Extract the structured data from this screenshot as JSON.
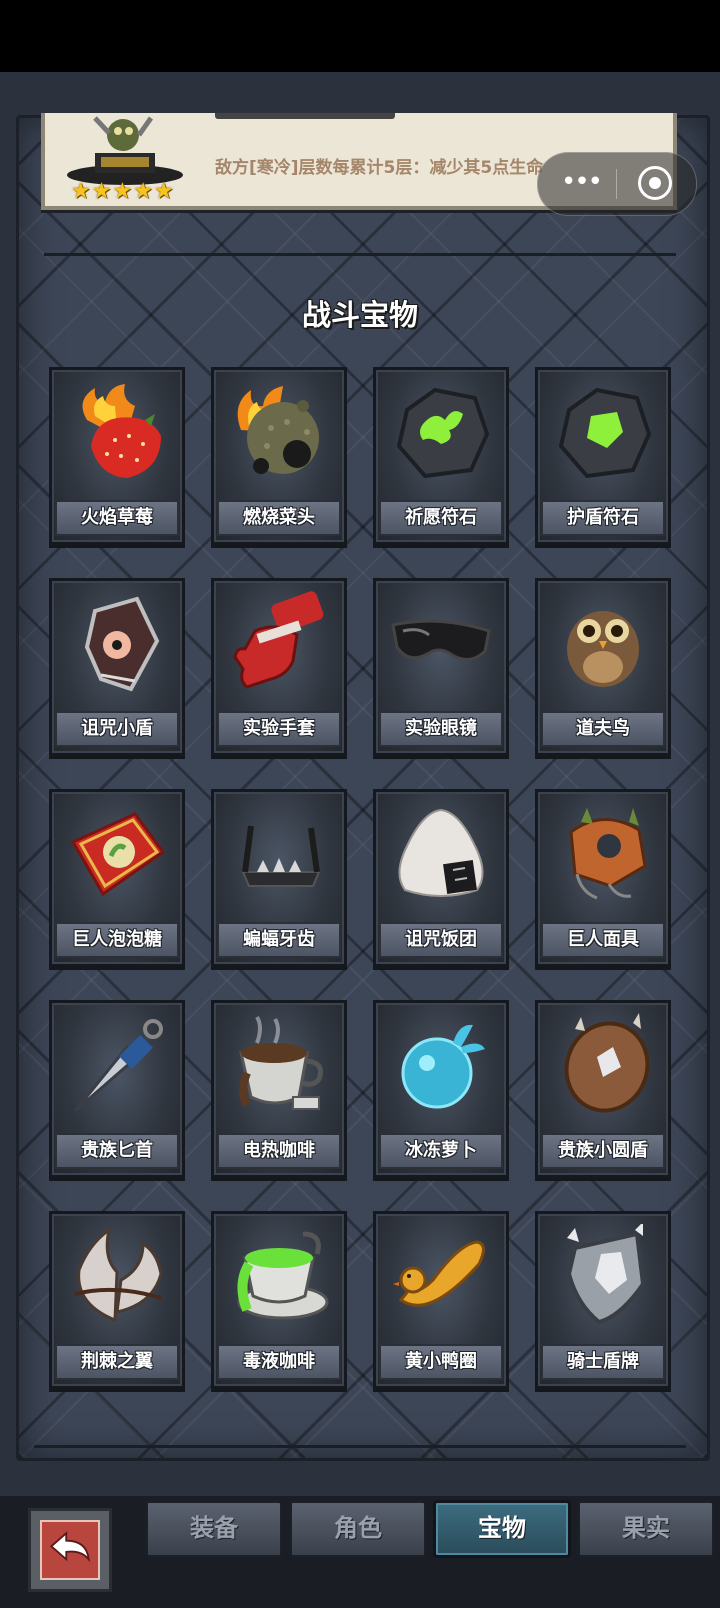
{
  "card": {
    "description": "敌方[寒冷]层数每累计5层：减少其5点生命",
    "stars": [
      "★",
      "★",
      "★",
      "★",
      "★"
    ]
  },
  "miniapp_capsule": {
    "more_icon": "more-dots-icon",
    "close_icon": "target-circle-icon",
    "more_glyph": "•••"
  },
  "section_title": "战斗宝物",
  "treasures": [
    {
      "label": "火焰草莓",
      "icon": "flame-strawberry-icon"
    },
    {
      "label": "燃烧菜头",
      "icon": "burning-veggie-icon"
    },
    {
      "label": "祈愿符石",
      "icon": "wish-rune-stone-icon"
    },
    {
      "label": "护盾符石",
      "icon": "shield-rune-stone-icon"
    },
    {
      "label": "诅咒小盾",
      "icon": "cursed-shield-icon"
    },
    {
      "label": "实验手套",
      "icon": "lab-glove-icon"
    },
    {
      "label": "实验眼镜",
      "icon": "lab-goggles-icon"
    },
    {
      "label": "道夫鸟",
      "icon": "owl-bird-icon"
    },
    {
      "label": "巨人泡泡糖",
      "icon": "bubblegum-box-icon"
    },
    {
      "label": "蝙蝠牙齿",
      "icon": "bat-teeth-icon"
    },
    {
      "label": "诅咒饭团",
      "icon": "cursed-riceball-icon"
    },
    {
      "label": "巨人面具",
      "icon": "giant-mask-icon"
    },
    {
      "label": "贵族匕首",
      "icon": "noble-dagger-icon"
    },
    {
      "label": "电热咖啡",
      "icon": "electric-coffee-icon"
    },
    {
      "label": "冰冻萝卜",
      "icon": "frozen-radish-icon"
    },
    {
      "label": "贵族小圆盾",
      "icon": "noble-buckler-icon"
    },
    {
      "label": "荆棘之翼",
      "icon": "thorn-wings-icon"
    },
    {
      "label": "毒液咖啡",
      "icon": "venom-coffee-icon"
    },
    {
      "label": "黄小鸭圈",
      "icon": "duck-ring-icon"
    },
    {
      "label": "骑士盾牌",
      "icon": "knight-shield-icon"
    }
  ],
  "tabs": [
    {
      "label": "装备",
      "active": false
    },
    {
      "label": "角色",
      "active": false
    },
    {
      "label": "宝物",
      "active": true
    },
    {
      "label": "果实",
      "active": false
    }
  ],
  "back_icon": "back-arrow-icon"
}
